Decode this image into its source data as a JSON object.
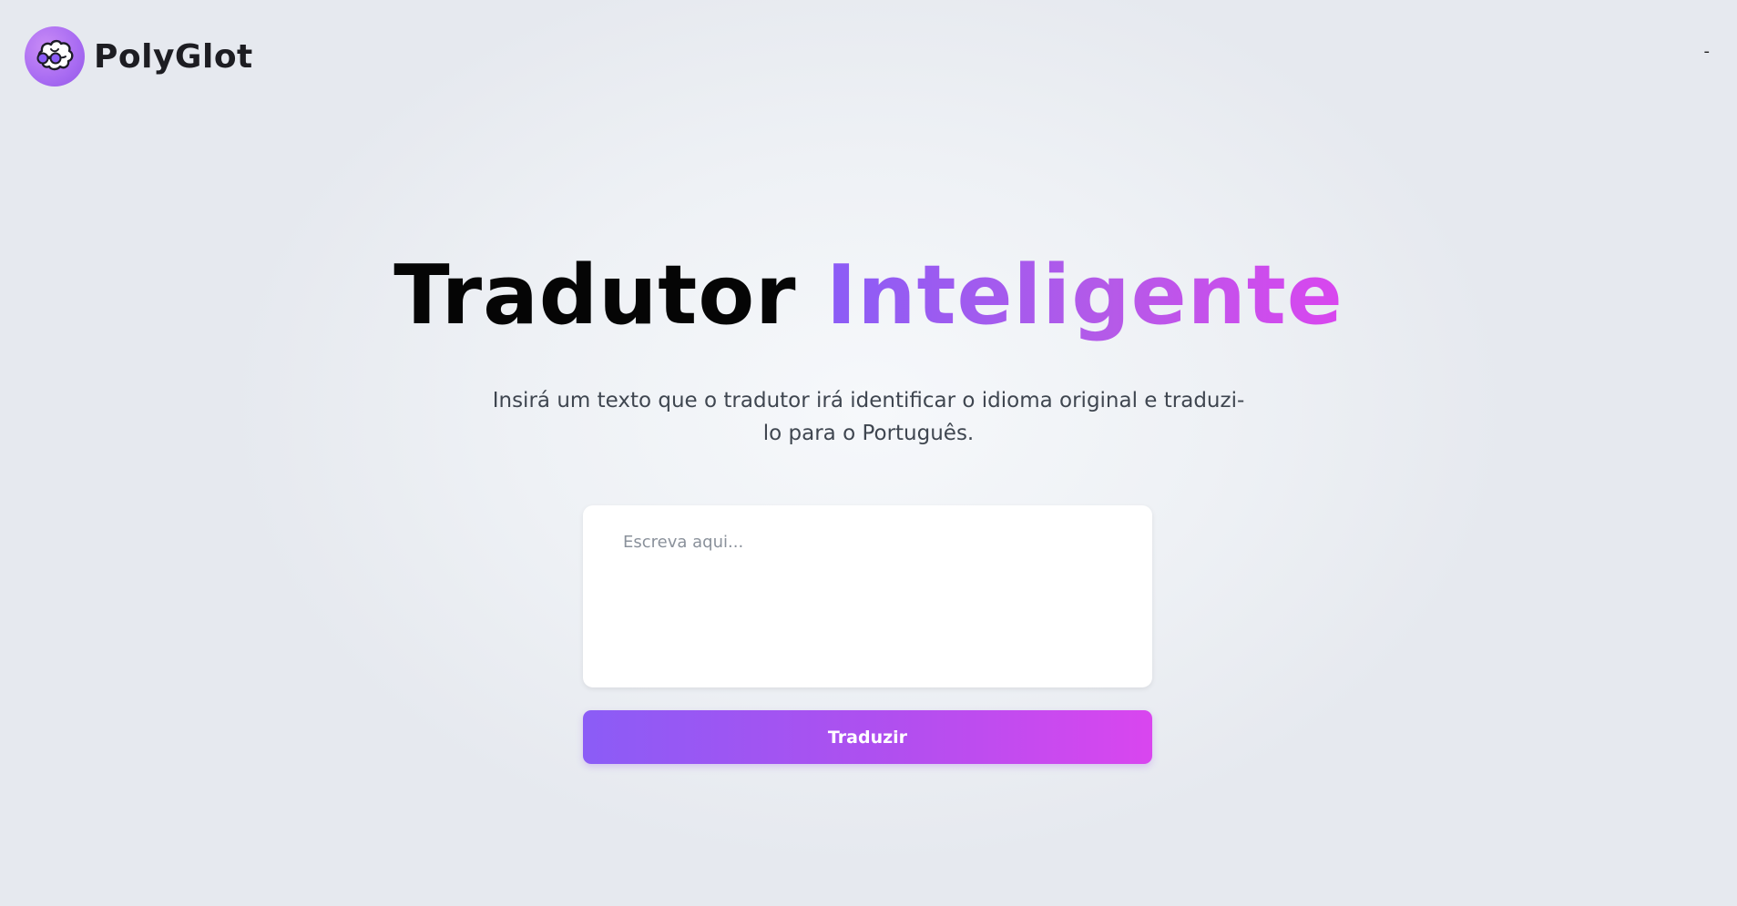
{
  "header": {
    "brand_name": "PolyGlot",
    "logo_icon": "brain-icon",
    "top_right_text": "-"
  },
  "hero": {
    "title_main": "Tradutor",
    "title_accent": "Inteligente",
    "subtitle": "Insirá um texto que o tradutor irá identificar o idioma original e traduzi-lo para o Português."
  },
  "form": {
    "input_value": "",
    "input_placeholder": "Escreva aqui...",
    "submit_label": "Traduzir"
  },
  "colors": {
    "accent_start": "#8b5cf6",
    "accent_end": "#d946ef",
    "title_text": "#050505",
    "subtitle_text": "#3f4650"
  }
}
